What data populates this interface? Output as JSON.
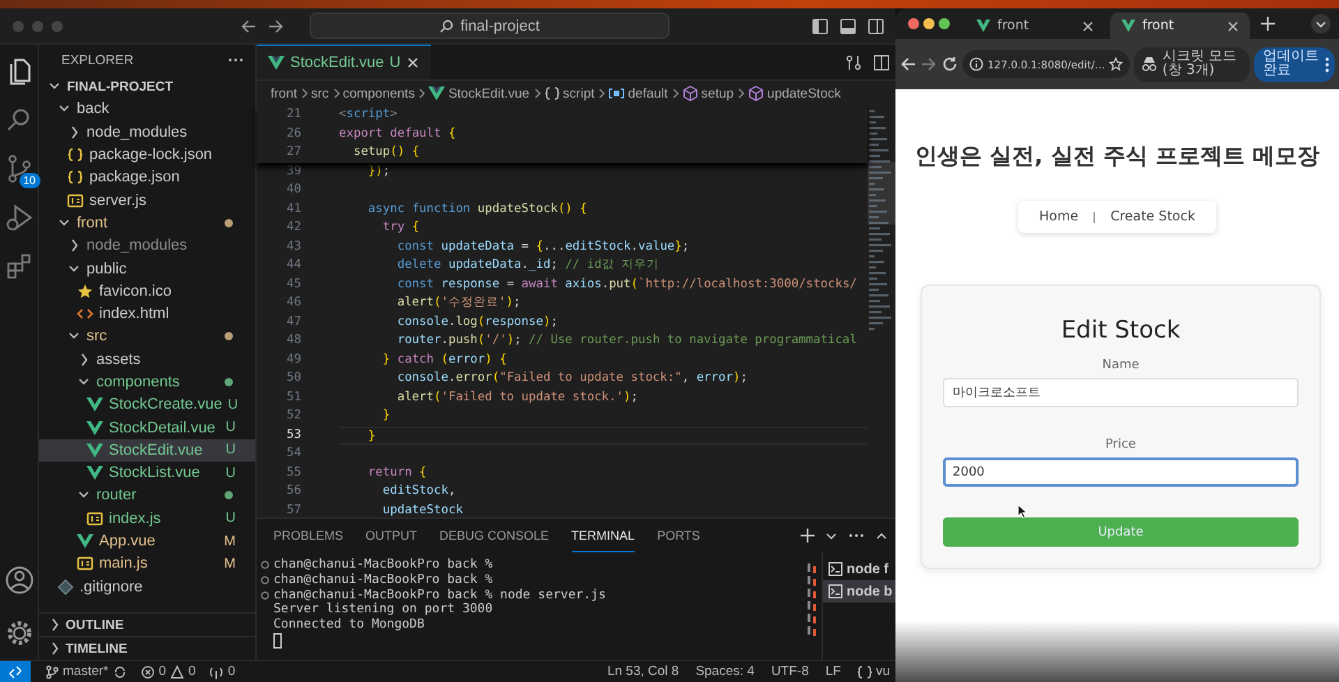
{
  "vscode": {
    "command_center": "final-project",
    "activity": [
      {
        "kind": "files",
        "selected": true
      },
      {
        "kind": "search",
        "selected": false
      },
      {
        "kind": "source-control",
        "selected": false,
        "badge": "10"
      },
      {
        "kind": "run",
        "selected": false
      },
      {
        "kind": "extensions",
        "selected": false
      }
    ],
    "explorer": {
      "title": "EXPLORER",
      "root": {
        "label": "FINAL-PROJECT",
        "expanded": true
      },
      "tree": [
        {
          "label": "back",
          "kind": "folder",
          "expanded": true,
          "selected": false,
          "color": "#cccccc",
          "children": [
            {
              "label": "node_modules",
              "kind": "folder",
              "expanded": false,
              "selected": false,
              "color": "#cccccc"
            },
            {
              "label": "package-lock.json",
              "kind": "json",
              "selected": false,
              "color": "#cccccc"
            },
            {
              "label": "package.json",
              "kind": "json",
              "selected": false,
              "color": "#cccccc"
            },
            {
              "label": "server.js",
              "kind": "js",
              "selected": false,
              "color": "#cccccc"
            }
          ]
        },
        {
          "label": "front",
          "kind": "folder",
          "expanded": true,
          "selected": false,
          "color": "#e2c08d",
          "dot": true,
          "children": [
            {
              "label": "node_modules",
              "kind": "folder",
              "expanded": false,
              "selected": false,
              "color": "#8c8c8c"
            },
            {
              "label": "public",
              "kind": "folder",
              "expanded": true,
              "selected": false,
              "color": "#cccccc",
              "children": [
                {
                  "label": "favicon.ico",
                  "kind": "star",
                  "selected": false,
                  "color": "#cccccc"
                },
                {
                  "label": "index.html",
                  "kind": "html",
                  "selected": false,
                  "color": "#cccccc"
                }
              ]
            },
            {
              "label": "src",
              "kind": "folder",
              "expanded": true,
              "selected": false,
              "color": "#e2c08d",
              "dot": true,
              "children": [
                {
                  "label": "assets",
                  "kind": "folder",
                  "expanded": false,
                  "selected": false,
                  "color": "#cccccc"
                },
                {
                  "label": "components",
                  "kind": "folder",
                  "expanded": true,
                  "selected": false,
                  "color": "#73c991",
                  "dot": true,
                  "children": [
                    {
                      "label": "StockCreate.vue",
                      "kind": "vue",
                      "selected": false,
                      "color": "#73c991",
                      "badge": "U"
                    },
                    {
                      "label": "StockDetail.vue",
                      "kind": "vue",
                      "selected": false,
                      "color": "#73c991",
                      "badge": "U"
                    },
                    {
                      "label": "StockEdit.vue",
                      "kind": "vue",
                      "selected": true,
                      "color": "#73c991",
                      "badge": "U"
                    },
                    {
                      "label": "StockList.vue",
                      "kind": "vue",
                      "selected": false,
                      "color": "#73c991",
                      "badge": "U"
                    }
                  ]
                },
                {
                  "label": "router",
                  "kind": "folder",
                  "expanded": true,
                  "selected": false,
                  "color": "#73c991",
                  "dot": true,
                  "children": [
                    {
                      "label": "index.js",
                      "kind": "js",
                      "selected": false,
                      "color": "#73c991",
                      "badge": "U"
                    }
                  ]
                },
                {
                  "label": "App.vue",
                  "kind": "vue",
                  "selected": false,
                  "color": "#e2c08d",
                  "badge": "M"
                },
                {
                  "label": "main.js",
                  "kind": "js",
                  "selected": false,
                  "color": "#e2c08d",
                  "badge": "M"
                }
              ]
            }
          ]
        },
        {
          "label": ".gitignore",
          "kind": "gitignore",
          "selected": false,
          "color": "#cccccc"
        }
      ]
    },
    "sections": [
      {
        "label": "OUTLINE",
        "expanded": false
      },
      {
        "label": "TIMELINE",
        "expanded": false
      }
    ],
    "editor": {
      "tab": {
        "label": "StockEdit.vue",
        "badge": "U"
      },
      "breadcrumbs": [
        {
          "label": "front",
          "kind": "folder"
        },
        {
          "label": "src",
          "kind": "folder"
        },
        {
          "label": "components",
          "kind": "folder"
        },
        {
          "label": "StockEdit.vue",
          "kind": "vue"
        },
        {
          "label": "script",
          "kind": "braces"
        },
        {
          "label": "default",
          "kind": "variable"
        },
        {
          "label": "setup",
          "kind": "method"
        },
        {
          "label": "updateStock",
          "kind": "method"
        }
      ],
      "sticky_lines": [
        {
          "number": "21",
          "code": "<script>"
        },
        {
          "number": "26",
          "code": "export default {"
        },
        {
          "number": "27",
          "code": "  setup() {"
        }
      ],
      "lines": [
        {
          "number": "39",
          "code": "    });",
          "current": false
        },
        {
          "number": "40",
          "current": false
        },
        {
          "number": "41",
          "code": "    async function updateStock() {",
          "current": false
        },
        {
          "number": "42",
          "code": "      try {",
          "current": false
        },
        {
          "number": "43",
          "code": "        const updateData = {...editStock.value};",
          "current": false
        },
        {
          "number": "44",
          "code": "        delete updateData._id; // id값 지우기",
          "current": false
        },
        {
          "number": "45",
          "code": "        const response = await axios.put(`http://localhost:3000/stocks/",
          "current": false
        },
        {
          "number": "46",
          "code": "        alert('수정완료');",
          "current": false
        },
        {
          "number": "47",
          "code": "        console.log(response);",
          "current": false
        },
        {
          "number": "48",
          "code": "        router.push('/'); // Use router.push to navigate programmatical",
          "current": false
        },
        {
          "number": "49",
          "code": "      } catch (error) {",
          "current": false
        },
        {
          "number": "50",
          "code": "        console.error(\"Failed to update stock:\", error);",
          "current": false
        },
        {
          "number": "51",
          "code": "        alert('Failed to update stock.');",
          "current": false
        },
        {
          "number": "52",
          "code": "      }",
          "current": false
        },
        {
          "number": "53",
          "code": "    }",
          "current": true
        },
        {
          "number": "54",
          "current": false
        },
        {
          "number": "55",
          "code": "    return {",
          "current": false
        },
        {
          "number": "56",
          "code": "      editStock,",
          "current": false
        },
        {
          "number": "57",
          "code": "      updateStock",
          "current": false
        }
      ]
    },
    "panel": {
      "tabs": [
        {
          "label": "PROBLEMS",
          "selected": false
        },
        {
          "label": "OUTPUT",
          "selected": false
        },
        {
          "label": "DEBUG CONSOLE",
          "selected": false
        },
        {
          "label": "TERMINAL",
          "selected": true
        },
        {
          "label": "PORTS",
          "selected": false
        }
      ],
      "terminal": [
        {
          "kind": "prompt",
          "text": "chan@chanui-MacBookPro back %"
        },
        {
          "kind": "prompt",
          "text": "chan@chanui-MacBookPro back %"
        },
        {
          "kind": "prompt",
          "text": "chan@chanui-MacBookPro back % node server.js"
        },
        {
          "kind": "output",
          "text": "Server listening on port 3000"
        },
        {
          "kind": "output",
          "text": "Connected to MongoDB"
        },
        {
          "kind": "cursor"
        }
      ],
      "sessions": [
        {
          "label": "node f",
          "selected": false
        },
        {
          "label": "node b",
          "selected": true
        }
      ]
    },
    "status": {
      "branch": "master*",
      "errors": "0",
      "warnings": "0",
      "ports": "0",
      "items": [
        "Ln 53, Col 8",
        "Spaces: 4",
        "UTF-8",
        "LF"
      ],
      "language": "vu"
    }
  },
  "browser": {
    "tabs": [
      {
        "title": "front",
        "selected": false
      },
      {
        "title": "front",
        "selected": true
      }
    ],
    "url": "127.0.0.1:8080/edit/…",
    "incognito": "시크릿 모드(창 3개)",
    "update_button": "업데이트 완료",
    "page": {
      "heading": "인생은 실전, 실전 주식 프로젝트 메모장",
      "nav": [
        "Home",
        "Create Stock"
      ],
      "form": {
        "title": "Edit Stock",
        "fields": [
          {
            "label": "Name",
            "value": "마이크로소프트",
            "focused": false
          },
          {
            "label": "Price",
            "value": "2000",
            "focused": true
          }
        ],
        "submit": "Update"
      }
    }
  }
}
